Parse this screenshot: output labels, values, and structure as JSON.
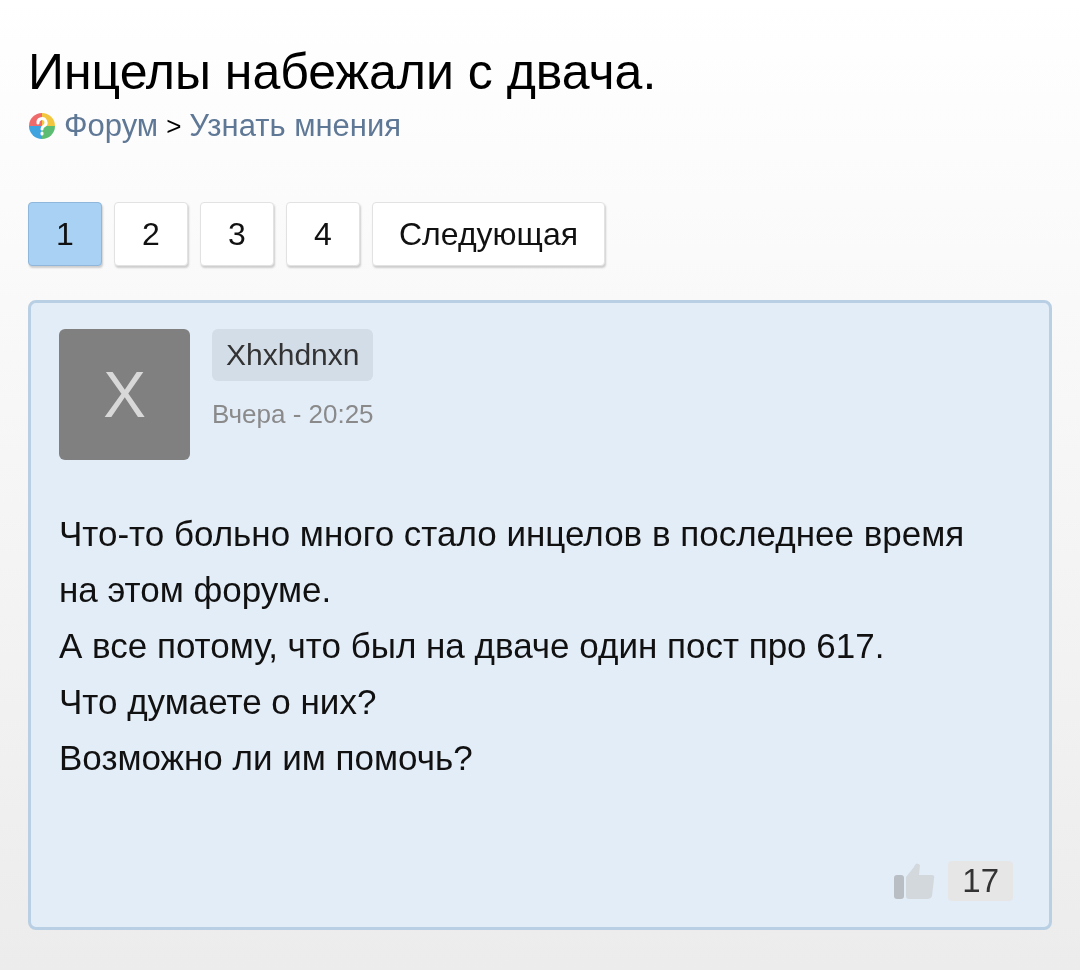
{
  "title": "Инцелы набежали с двача.",
  "breadcrumb": {
    "items": [
      "Форум",
      "Узнать мнения"
    ],
    "separator": ">"
  },
  "pagination": [
    {
      "label": "1",
      "selected": true
    },
    {
      "label": "2",
      "selected": false
    },
    {
      "label": "3",
      "selected": false
    },
    {
      "label": "4",
      "selected": false
    },
    {
      "label": "Следующая",
      "selected": false
    }
  ],
  "post": {
    "avatar_letter": "X",
    "author": "Xhxhdnxn",
    "time": "Вчера - 20:25",
    "paragraphs": [
      "Что-то больно много стало инцелов в последнее время на этом форуме.",
      "А все потому, что был на дваче один пост про 617.",
      "Что думаете о них?",
      "Возможно ли им помочь?"
    ],
    "likes": "17"
  }
}
